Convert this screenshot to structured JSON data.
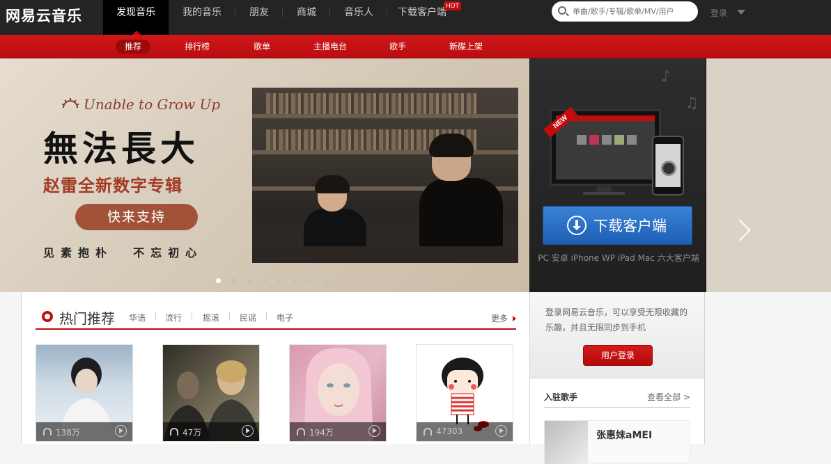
{
  "app": {
    "logo": "网易云音乐"
  },
  "nav": {
    "items": [
      {
        "label": "发现音乐"
      },
      {
        "label": "我的音乐"
      },
      {
        "label": "朋友"
      },
      {
        "label": "商城"
      },
      {
        "label": "音乐人"
      },
      {
        "label": "下载客户端"
      }
    ],
    "hot_badge": "HOT",
    "search_placeholder": "单曲/歌手/专辑/歌单/MV/用户",
    "login": "登录"
  },
  "subnav": {
    "items": [
      {
        "label": "推荐"
      },
      {
        "label": "排行榜"
      },
      {
        "label": "歌单"
      },
      {
        "label": "主播电台"
      },
      {
        "label": "歌手"
      },
      {
        "label": "新碟上架"
      }
    ]
  },
  "banner": {
    "eng_title": "Unable to Grow Up",
    "title": "無法長大",
    "subtitle": "赵雷全新数字专辑",
    "button": "快来支持",
    "slogan": "见素抱朴  不忘初心",
    "dots_count": 8,
    "active_dot": 0
  },
  "download": {
    "new_badge": "NEW",
    "button": "下载客户端",
    "caption": "PC 安卓 iPhone WP iPad Mac 六大客户端"
  },
  "hot": {
    "title": "热门推荐",
    "tags": [
      "华语",
      "流行",
      "摇滚",
      "民谣",
      "电子"
    ],
    "more": "更多",
    "cards": [
      {
        "count": "138万"
      },
      {
        "count": "47万"
      },
      {
        "count": "194万"
      },
      {
        "count": "47303"
      }
    ]
  },
  "side": {
    "login_text": "登录网易云音乐，可以享受无限收藏的乐趣，并且无限同步到手机",
    "login_button": "用户登录",
    "singers_title": "入驻歌手",
    "view_all": "查看全部 >",
    "singer_name": "张惠妹aMEI"
  },
  "colors": {
    "topbar": "#242424",
    "brand_red": "#c20c0c",
    "download_blue": "#2d74c8"
  }
}
